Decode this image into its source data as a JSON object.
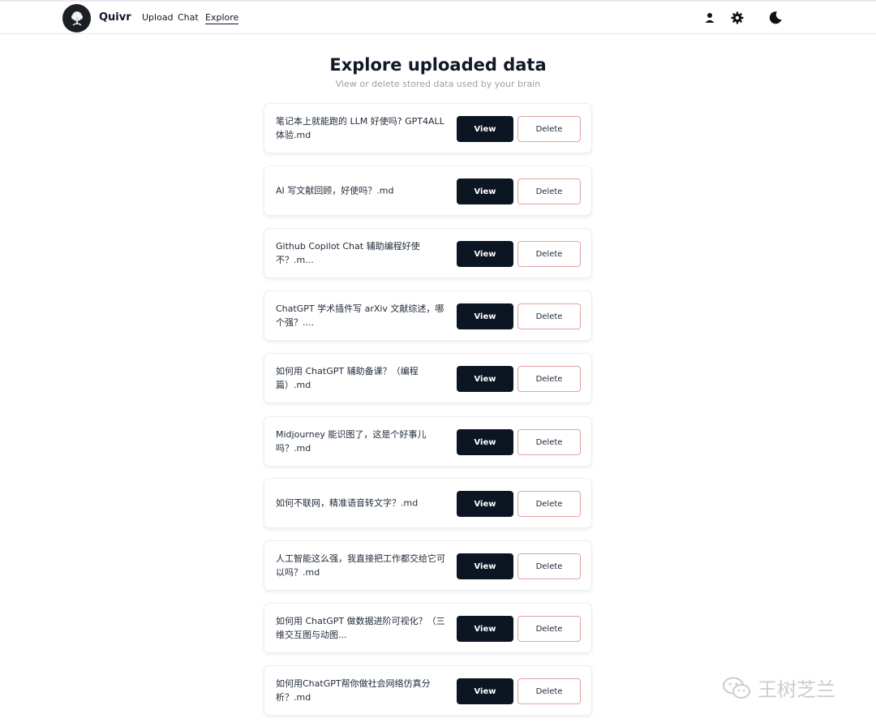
{
  "header": {
    "brand": "Quivr",
    "nav": [
      {
        "label": "Upload"
      },
      {
        "label": "Chat"
      },
      {
        "label": "Explore",
        "active": true
      }
    ],
    "icons": [
      "user-icon",
      "gear-icon",
      "moon-icon"
    ]
  },
  "main": {
    "title": "Explore uploaded data",
    "subtitle": "View or delete stored data used by your brain",
    "items": [
      {
        "name": "笔记本上就能跑的 LLM 好使吗? GPT4ALL 体验.md",
        "view_label": "View",
        "delete_label": "Delete"
      },
      {
        "name": "AI 写文献回顾，好使吗？.md",
        "view_label": "View",
        "delete_label": "Delete"
      },
      {
        "name": "Github Copilot Chat 辅助编程好使不？.m...",
        "view_label": "View",
        "delete_label": "Delete"
      },
      {
        "name": "ChatGPT 学术插件写 arXiv 文献综述，哪个强？....",
        "view_label": "View",
        "delete_label": "Delete"
      },
      {
        "name": "如何用 ChatGPT 辅助备课？（编程篇）.md",
        "view_label": "View",
        "delete_label": "Delete"
      },
      {
        "name": "Midjourney 能识图了，这是个好事儿吗？.md",
        "view_label": "View",
        "delete_label": "Delete"
      },
      {
        "name": "如何不联网，精准语音转文字？.md",
        "view_label": "View",
        "delete_label": "Delete"
      },
      {
        "name": "人工智能这么强，我直接把工作都交给它可以吗？.md",
        "view_label": "View",
        "delete_label": "Delete"
      },
      {
        "name": "如何用 ChatGPT 做数据进阶可视化？（三维交互图与动图...",
        "view_label": "View",
        "delete_label": "Delete"
      },
      {
        "name": "如何用ChatGPT帮你做社会网络仿真分析？.md",
        "view_label": "View",
        "delete_label": "Delete"
      }
    ]
  },
  "watermark": {
    "text": "王树芝兰"
  },
  "colors": {
    "primary_button": "#0b1622",
    "delete_border": "#e4a3a3",
    "subtitle": "#9aa0a8"
  }
}
